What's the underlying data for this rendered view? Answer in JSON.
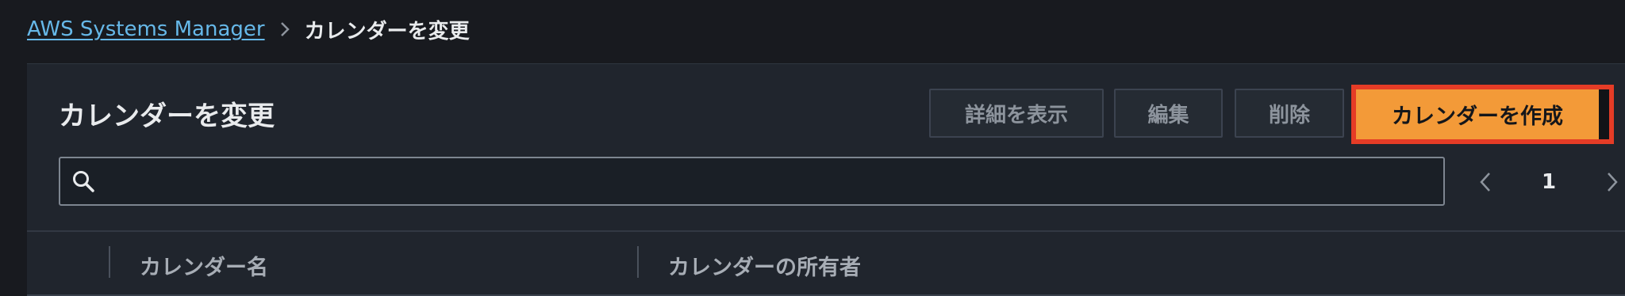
{
  "breadcrumb": {
    "root_label": "AWS Systems Manager",
    "separator_icon": "chevron-right-icon",
    "current_label": "カレンダーを変更"
  },
  "panel": {
    "title": "カレンダーを変更",
    "buttons": {
      "view_details": "詳細を表示",
      "edit": "編集",
      "delete": "削除",
      "create_calendar": "カレンダーを作成"
    }
  },
  "search": {
    "placeholder": "",
    "value": "",
    "icon": "search-icon"
  },
  "pagination": {
    "current_page": "1",
    "prev_icon": "chevron-left-icon",
    "next_icon": "chevron-right-icon"
  },
  "table": {
    "columns": [
      "カレンダー名",
      "カレンダーの所有者"
    ]
  },
  "colors": {
    "primary_button": "#f39a38",
    "highlight_border": "#e53c26",
    "link": "#66b8e8"
  }
}
